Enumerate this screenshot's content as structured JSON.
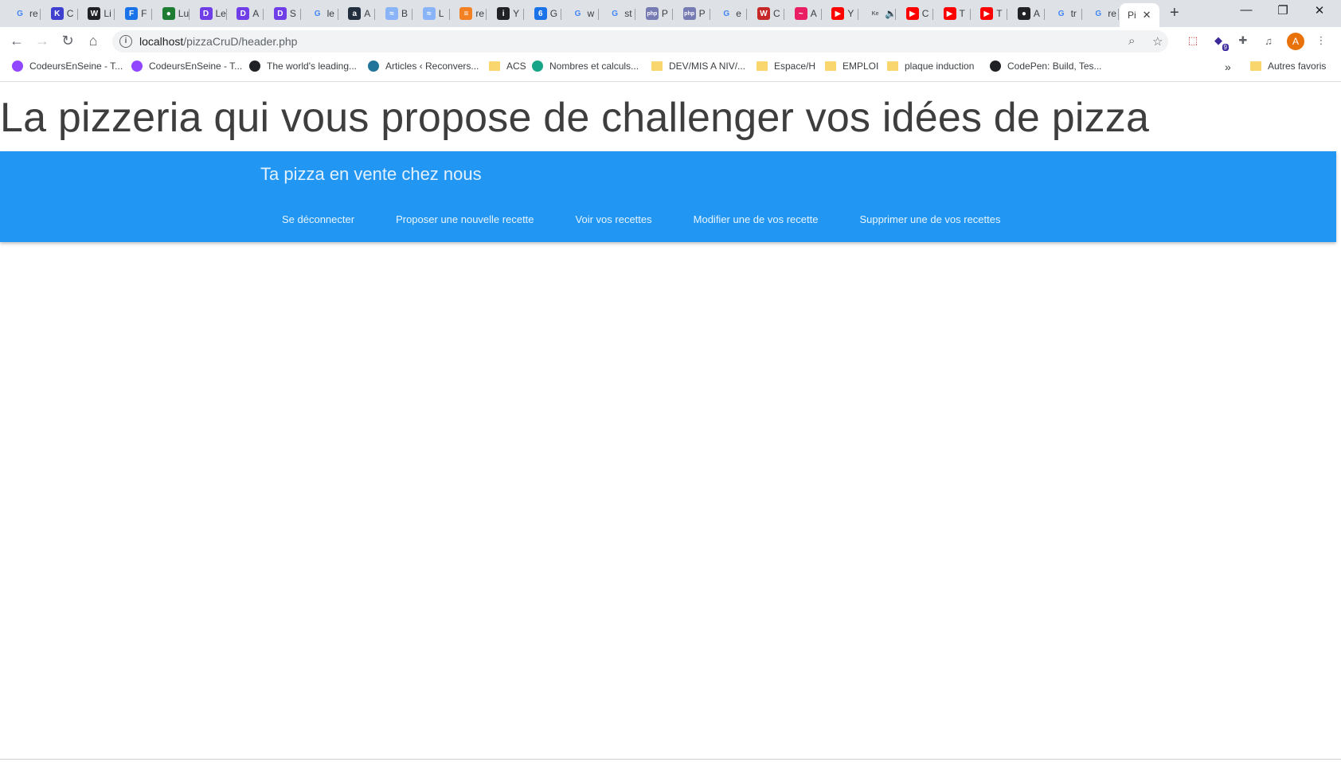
{
  "browser": {
    "tabs": [
      {
        "icon": "google-icon",
        "letter": "G",
        "color": "#4285f4",
        "title": "re"
      },
      {
        "icon": "k-icon",
        "letter": "K",
        "color": "#3f3fd0",
        "title": "C"
      },
      {
        "icon": "w-icon",
        "letter": "W",
        "color": "#202124",
        "title": "Li"
      },
      {
        "icon": "f-icon",
        "letter": "F",
        "color": "#1a73e8",
        "title": "F"
      },
      {
        "icon": "globe-icon",
        "letter": "●",
        "color": "#1e7d32",
        "title": "Lu"
      },
      {
        "icon": "d-icon",
        "letter": "D",
        "color": "#6f3ee8",
        "title": "Le"
      },
      {
        "icon": "d-icon",
        "letter": "D",
        "color": "#6f3ee8",
        "title": "A"
      },
      {
        "icon": "d-icon",
        "letter": "D",
        "color": "#6f3ee8",
        "title": "S"
      },
      {
        "icon": "google-icon",
        "letter": "G",
        "color": "#4285f4",
        "title": "le"
      },
      {
        "icon": "amazon-icon",
        "letter": "a",
        "color": "#232f3e",
        "title": "A"
      },
      {
        "icon": "b-icon",
        "letter": "≈",
        "color": "#8ab4f8",
        "title": "B"
      },
      {
        "icon": "b-icon",
        "letter": "≈",
        "color": "#8ab4f8",
        "title": "L"
      },
      {
        "icon": "stack-icon",
        "letter": "≡",
        "color": "#f48024",
        "title": "re"
      },
      {
        "icon": "info-icon",
        "letter": "i",
        "color": "#202124",
        "title": "Y"
      },
      {
        "icon": "g6-icon",
        "letter": "6",
        "color": "#1a73e8",
        "title": "G"
      },
      {
        "icon": "google-icon",
        "letter": "G",
        "color": "#4285f4",
        "title": "w"
      },
      {
        "icon": "google-icon",
        "letter": "G",
        "color": "#4285f4",
        "title": "st"
      },
      {
        "icon": "php-icon",
        "letter": "php",
        "color": "#777bb3",
        "title": "P"
      },
      {
        "icon": "php-icon",
        "letter": "php",
        "color": "#777bb3",
        "title": "P"
      },
      {
        "icon": "google-icon",
        "letter": "G",
        "color": "#4285f4",
        "title": "e"
      },
      {
        "icon": "w3-icon",
        "letter": "W",
        "color": "#c62828",
        "title": "C"
      },
      {
        "icon": "scribble-icon",
        "letter": "~",
        "color": "#e91e63",
        "title": "A"
      },
      {
        "icon": "youtube-icon",
        "letter": "▶",
        "color": "#ff0000",
        "title": "Y"
      },
      {
        "icon": "ke-icon",
        "letter": "Ke",
        "color": "#5f6368",
        "title": "🔈"
      },
      {
        "icon": "youtube-icon",
        "letter": "▶",
        "color": "#ff0000",
        "title": "C"
      },
      {
        "icon": "youtube-icon",
        "letter": "▶",
        "color": "#ff0000",
        "title": "T"
      },
      {
        "icon": "youtube-icon",
        "letter": "▶",
        "color": "#ff0000",
        "title": "T"
      },
      {
        "icon": "github-icon",
        "letter": "●",
        "color": "#202124",
        "title": "A"
      },
      {
        "icon": "google-icon",
        "letter": "G",
        "color": "#4285f4",
        "title": "tr"
      },
      {
        "icon": "google-icon",
        "letter": "G",
        "color": "#4285f4",
        "title": "re"
      }
    ],
    "active_tab": {
      "title": "Pi",
      "close": "✕"
    },
    "new_tab_symbol": "+",
    "window_controls": {
      "minimize": "—",
      "restore": "❐",
      "close": "✕"
    },
    "url_host": "localhost",
    "url_path": "/pizzaCruD/header.php",
    "profile_initial": "A",
    "extension_badge": "9"
  },
  "bookmarks": [
    {
      "icon": "twitch-icon",
      "color": "#9146ff",
      "label": "CodeursEnSeine - T..."
    },
    {
      "icon": "twitch-icon",
      "color": "#9146ff",
      "label": "CodeursEnSeine - T..."
    },
    {
      "icon": "github-icon",
      "color": "#202124",
      "label": "The world's leading..."
    },
    {
      "icon": "wordpress-icon",
      "color": "#21759b",
      "label": "Articles ‹ Reconvers..."
    },
    {
      "icon": "folder-icon",
      "color": "#f9d66e",
      "label": "ACS"
    },
    {
      "icon": "nombres-icon",
      "color": "#17a589",
      "label": "Nombres et calculs..."
    },
    {
      "icon": "folder-icon",
      "color": "#f9d66e",
      "label": "DEV/MIS A NIV/..."
    },
    {
      "icon": "folder-icon",
      "color": "#f9d66e",
      "label": "Espace/H"
    },
    {
      "icon": "folder-icon",
      "color": "#f9d66e",
      "label": "EMPLOI"
    },
    {
      "icon": "folder-icon",
      "color": "#f9d66e",
      "label": "plaque induction"
    },
    {
      "icon": "codepen-icon",
      "color": "#202124",
      "label": "CodePen: Build, Tes..."
    }
  ],
  "bookmarks_more": "»",
  "other_bookmarks": "Autres favoris",
  "page": {
    "title": "La pizzeria qui vous propose de challenger vos idées de pizza",
    "brand": "Ta pizza en vente chez nous",
    "nav": [
      "Se déconnecter",
      "Proposer une nouvelle recette",
      "Voir vos recettes",
      "Modifier une de vos recette",
      "Supprimer une de vos recettes"
    ],
    "accent": "#2196f3"
  }
}
